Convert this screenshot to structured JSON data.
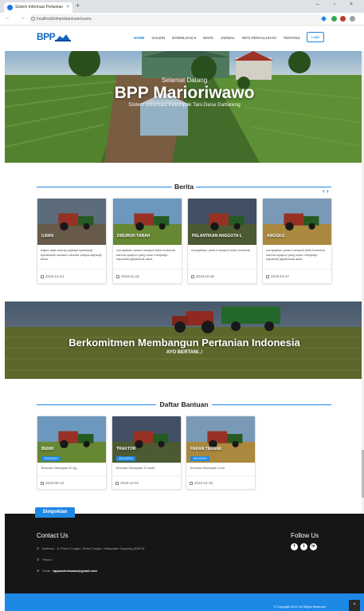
{
  "browser": {
    "tab_title": "Sistem Informasi Pertanian",
    "url": "localhost/simpoktan/user/users",
    "close_glyph": "×",
    "new_tab_glyph": "+",
    "window_controls": "–  ▫  ×",
    "nav_glyphs": "← → C"
  },
  "site": {
    "logo_text": "BPP",
    "nav": [
      "HOME",
      "GALERI",
      "DOWNLOAD ▾",
      "MAPS",
      "JADWAL",
      "INFO PENYULUHAN",
      "TENTANG"
    ],
    "active_nav": "HOME",
    "login_label": "Login"
  },
  "hero": {
    "welcome": "Selamat Datang",
    "title": "BPP Marioriwawo",
    "subtitle": "Sistem Informasi Kelompok Tani Desa Gattareng"
  },
  "berita": {
    "heading": "Berita",
    "nav_arrows": "‹ ›",
    "cards": [
      {
        "label": "UJIAN",
        "desc": "bajkld adjls asankj adjlkajd bjadkasdj bjadkbaslk asdasvn aksalsl cdbjsa adjhsdly biwut",
        "date": "2019-12-24",
        "accent": "#5b6b7c"
      },
      {
        "label": "DISURUH TABAH",
        "desc": "menjadikan petani menjadi lebih berbahal karena apapun yang kane menjadiju kapastial jajkdbasdk aksd",
        "date": "2019-11-15",
        "accent": "#6a8f3a"
      },
      {
        "label": "PELANTIKAN ANGGOTA L",
        "desc": "menjadikan petani menjadi lebih berbahal",
        "date": "2019-10-30",
        "accent": "#3c4f68"
      },
      {
        "label": "ANGGKG",
        "desc": "menjadikan petani menjadi lebih berbahal karena apapun yang kane menjadiju kapastial jajkdbasdk aksd",
        "date": "2019-10-27",
        "accent": "#c9a34a"
      }
    ]
  },
  "banner": {
    "title": "Berkomitmen Membangun Pertanian Indonesia",
    "subtitle": "AYO BERTANI..!"
  },
  "bantuan": {
    "heading": "Daftar Bantuan",
    "cards": [
      {
        "label": "BENIH",
        "badge": "19/09/2019",
        "desc": "Tersedia Sebanyak 20 kg",
        "date": "2019-09-13"
      },
      {
        "label": "TRAKTOR",
        "badge": "20/12/2019",
        "desc": "Tersedia Sebanyak 20 buah",
        "date": "2019-12-02"
      },
      {
        "label": "PAKAN TERNAK",
        "badge": "19/12/2019",
        "desc": "Tersedia Sebanyak 3 ton",
        "date": "2019-12-18"
      }
    ]
  },
  "footer": {
    "tab_label": "Simpoktan",
    "contact_title": "Contact Us",
    "address_label": "Address :",
    "address_value": "Jl. Poros Congko, Desa Congko, Kabupaten Soppeng (90874)",
    "phone_label": "Phone :",
    "phone_value": "",
    "email_label": "Email :",
    "email_value": "bppmarioriwawo@gmail.com",
    "follow_title": "Follow Us",
    "social": [
      "f",
      "t",
      "in"
    ],
    "copyright": "© Copyright 2019. All Rights Reserved",
    "to_top_glyph": "^"
  }
}
